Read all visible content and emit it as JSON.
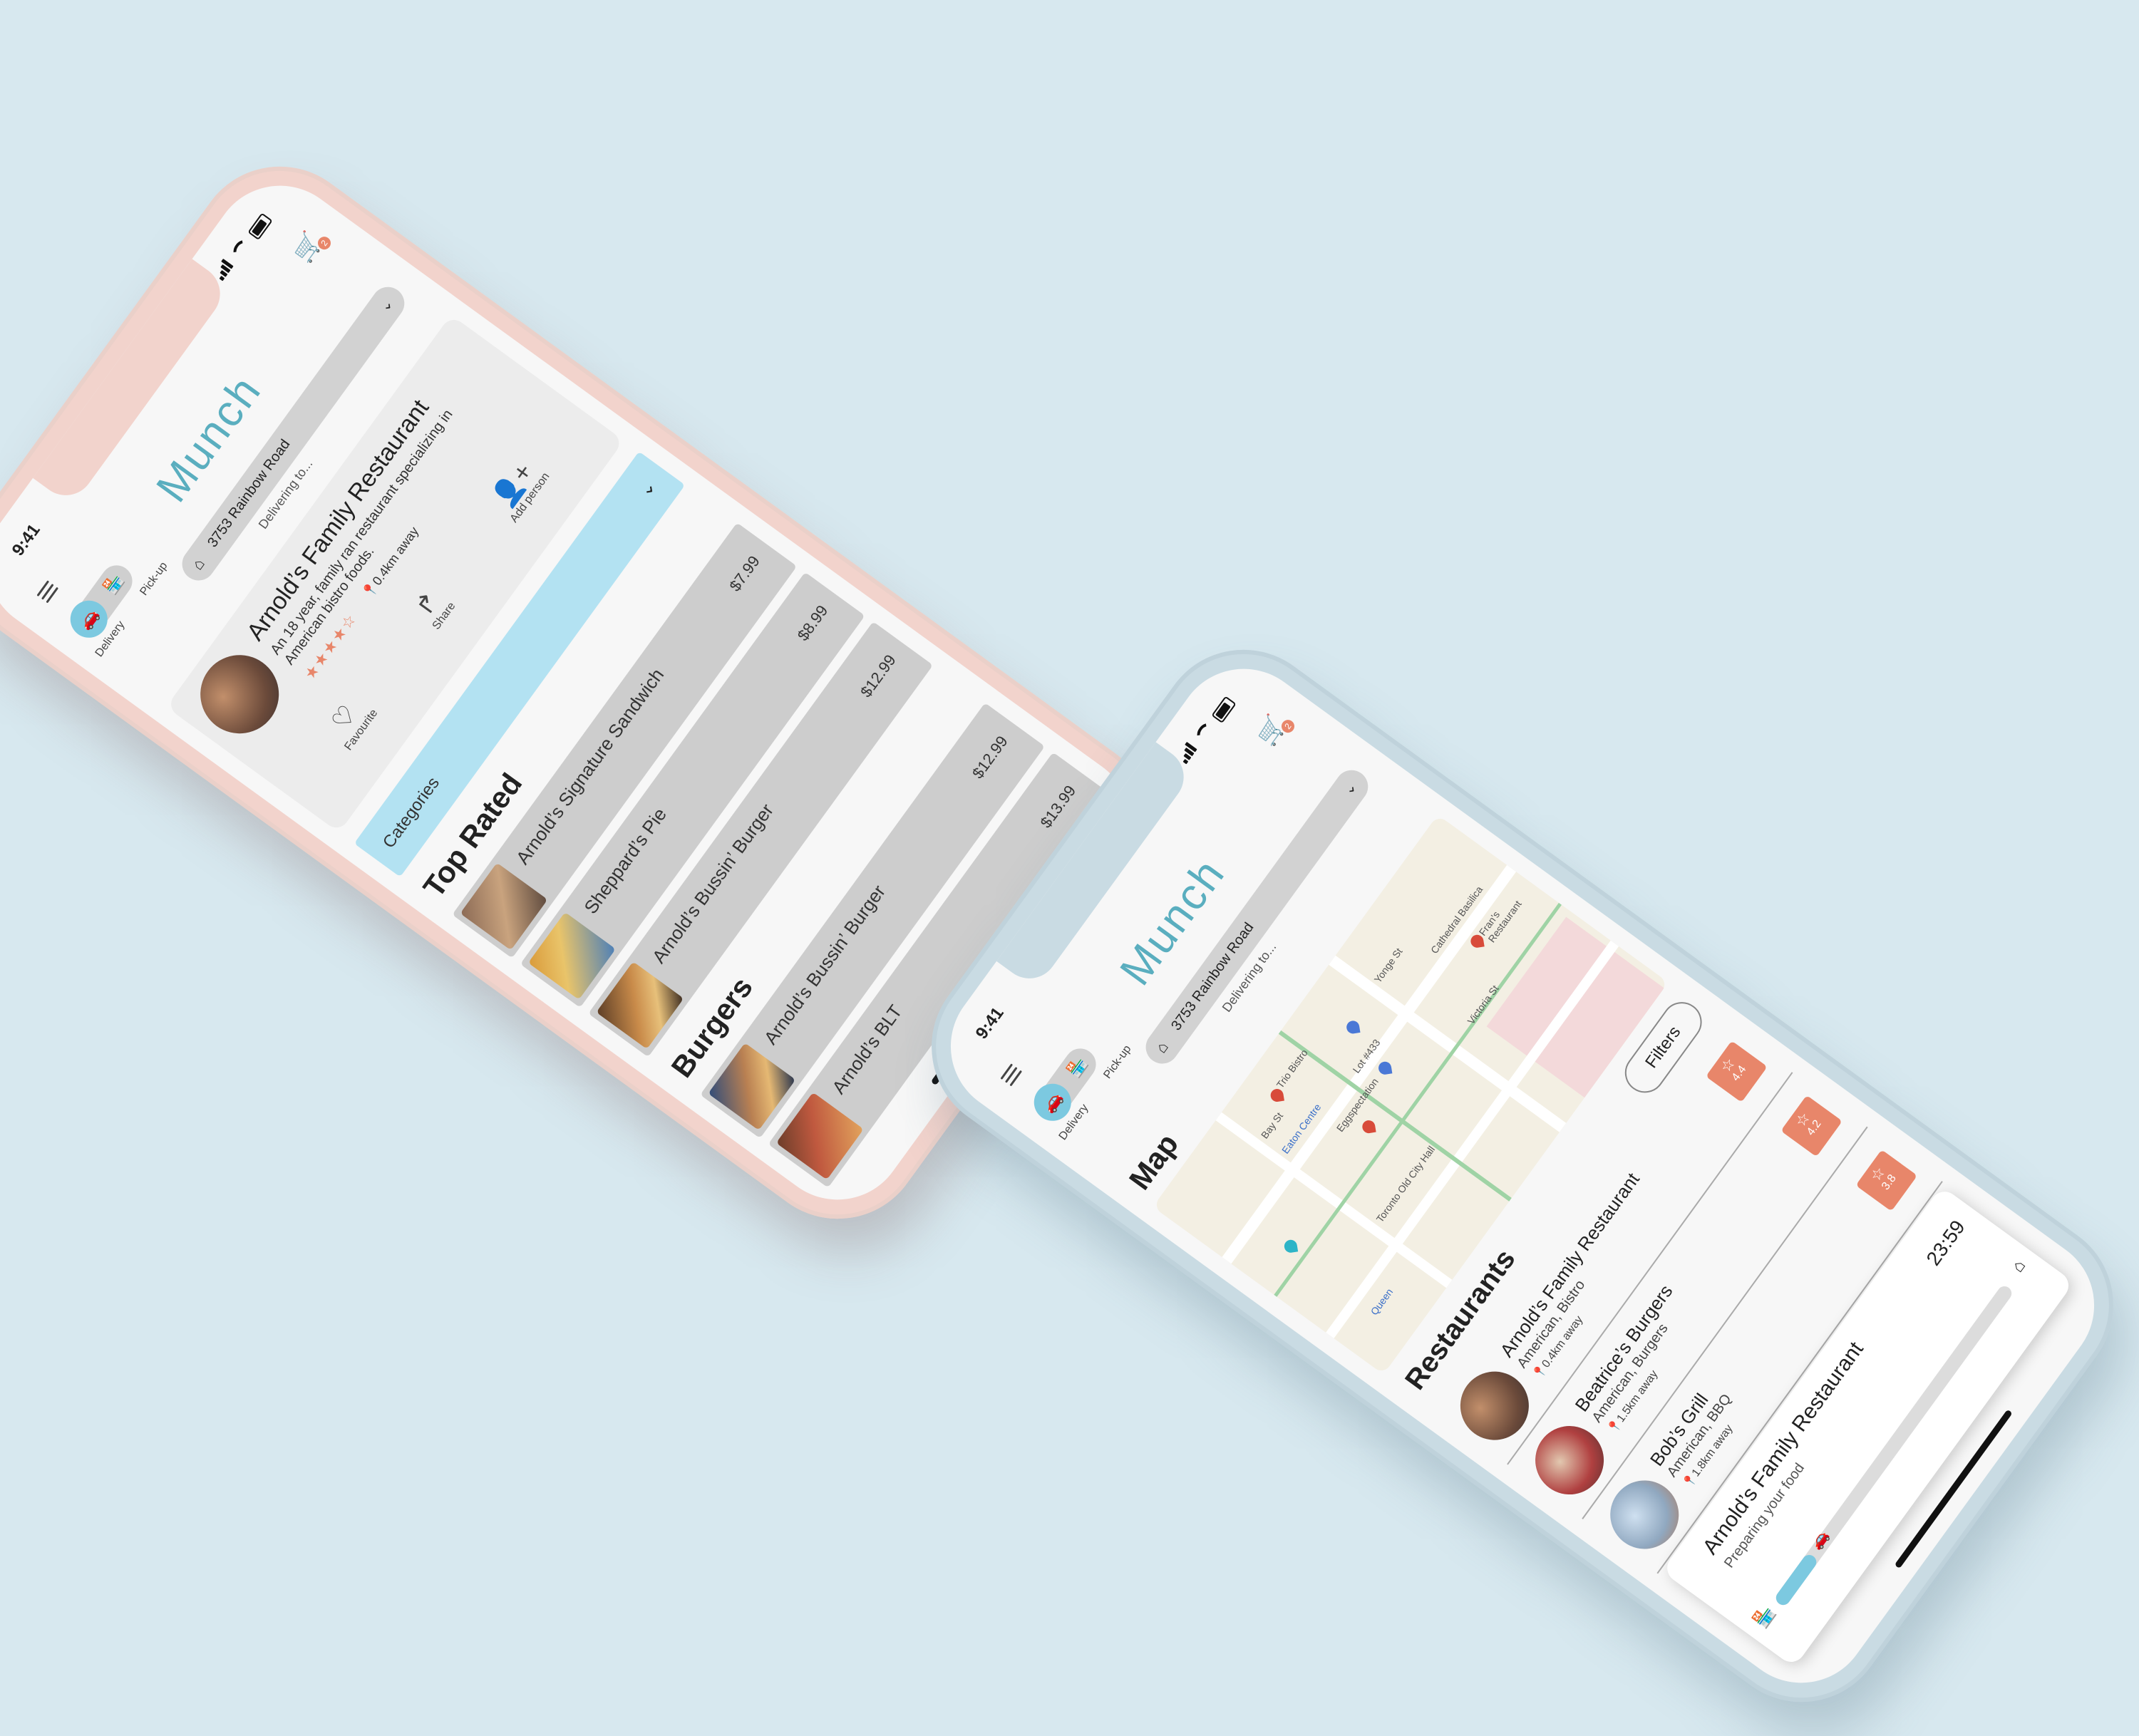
{
  "app": {
    "name": "Munch",
    "time": "9:41",
    "cart_count": "2"
  },
  "colors": {
    "accent": "#5aaebf",
    "toggle": "#7cc9e0",
    "rating": "#e8866a",
    "categories_bg": "#b3e2f2"
  },
  "header": {
    "toggle_left": "Delivery",
    "toggle_right": "Pick-up",
    "address": "3753 Rainbow Road",
    "delivering_label": "Delivering to..."
  },
  "icons": [
    "menu-icon",
    "cart-icon",
    "car-icon",
    "store-icon",
    "home-icon",
    "chevron-down-icon",
    "heart-icon",
    "share-icon",
    "add-person-icon",
    "star-icon",
    "pin-icon"
  ],
  "left_screen": {
    "restaurant": {
      "name": "Arnold’s Family Restaurant",
      "description": "An 18 year, family ran restaurant specializing in American bistro foods.",
      "rating_stars": 4,
      "distance": "0.4km away"
    },
    "actions": [
      {
        "label": "Favourite",
        "icon": "heart-icon"
      },
      {
        "label": "Share",
        "icon": "share-icon"
      },
      {
        "label": "Add person",
        "icon": "add-person-icon"
      }
    ],
    "categories_label": "Categories",
    "sections": [
      {
        "title": "Top Rated",
        "items": [
          {
            "name": "Arnold’s Signature Sandwich",
            "price": "$7.99"
          },
          {
            "name": "Sheppard’s Pie",
            "price": "$8.99"
          },
          {
            "name": "Arnold’s Bussin’ Burger",
            "price": "$12.99"
          }
        ]
      },
      {
        "title": "Burgers",
        "items": [
          {
            "name": "Arnold’s Bussin’ Burger",
            "price": "$12.99"
          },
          {
            "name": "Arnold’s BLT",
            "price": "$13.99"
          }
        ]
      }
    ]
  },
  "right_screen": {
    "map_title": "Map",
    "map_labels": [
      "Trio Bistro",
      "Eaton Centre",
      "Eggspectation",
      "Lot #433",
      "Yonge St",
      "Toronto Old City Hall",
      "Fran's Restaurant",
      "Victoria St",
      "Queen",
      "Bay St",
      "Cathedral Basilica"
    ],
    "restaurants_title": "Restaurants",
    "filters_label": "Filters",
    "restaurants": [
      {
        "name": "Arnold’s Family Restaurant",
        "cuisine": "American, Bistro",
        "distance": "0.4km away",
        "rating": "4.4"
      },
      {
        "name": "Beatrice’s Burgers",
        "cuisine": "American, Burgers",
        "distance": "1.5km away",
        "rating": "4.2"
      },
      {
        "name": "Bob’s Grill",
        "cuisine": "American, BBQ",
        "distance": "1.8km away",
        "rating": "3.8"
      }
    ],
    "order": {
      "restaurant": "Arnold’s Family Restaurant",
      "status": "Preparing your food",
      "time_left": "23:59",
      "progress": 0.15
    }
  }
}
